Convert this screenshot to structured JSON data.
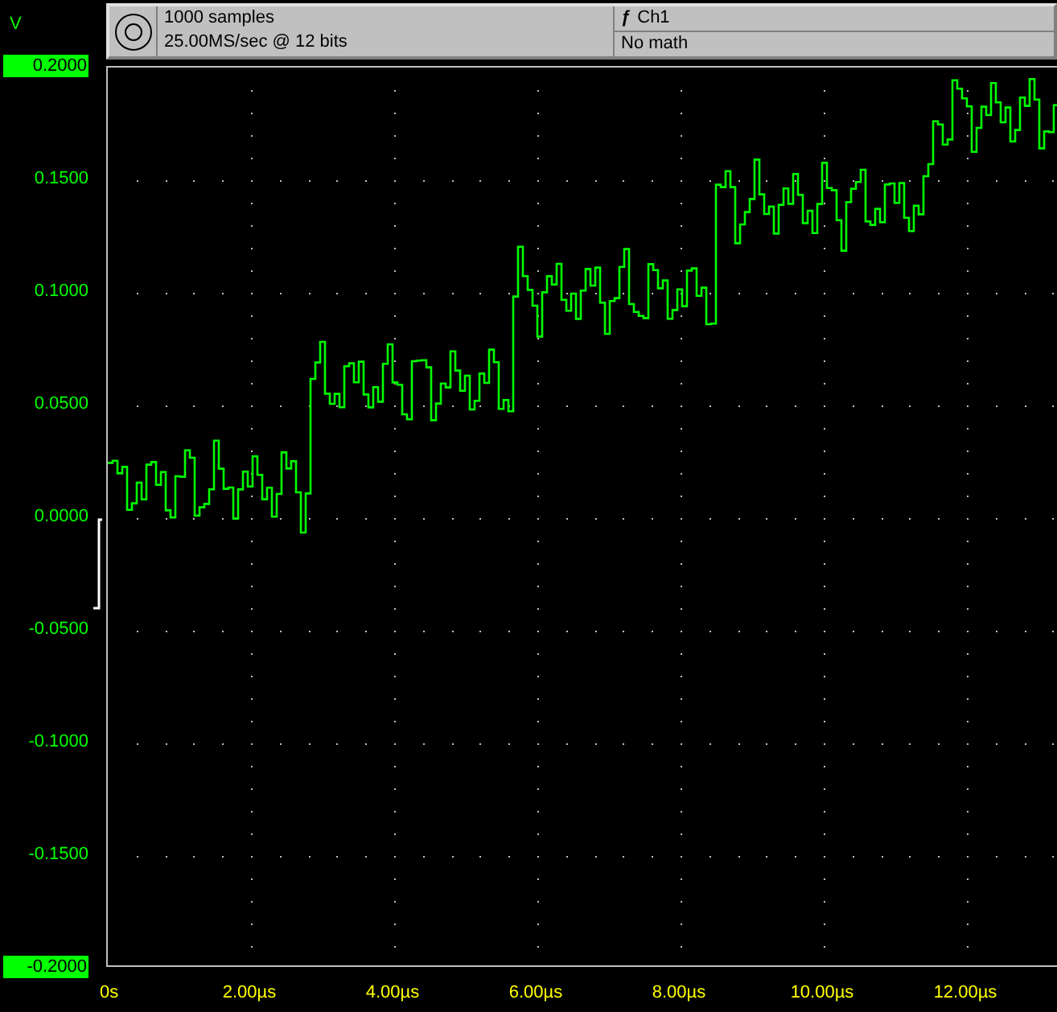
{
  "header": {
    "samples": "1000 samples",
    "rate": "25.00MS/sec @ 12 bits",
    "channel_icon": "ƒ",
    "channel": "Ch1",
    "math": "No math"
  },
  "y_unit": "V",
  "y_labels": [
    {
      "text": "0.2000",
      "highlighted": true
    },
    {
      "text": "0.1500",
      "highlighted": false
    },
    {
      "text": "0.1000",
      "highlighted": false
    },
    {
      "text": "0.0500",
      "highlighted": false
    },
    {
      "text": "0.0000",
      "highlighted": false
    },
    {
      "text": "-0.0500",
      "highlighted": false
    },
    {
      "text": "-0.1000",
      "highlighted": false
    },
    {
      "text": "-0.1500",
      "highlighted": false
    },
    {
      "text": "-0.2000",
      "highlighted": true
    }
  ],
  "x_labels": [
    "0s",
    "2.00µs",
    "4.00µs",
    "6.00µs",
    "8.00µs",
    "10.00µs",
    "12.00µs"
  ]
}
